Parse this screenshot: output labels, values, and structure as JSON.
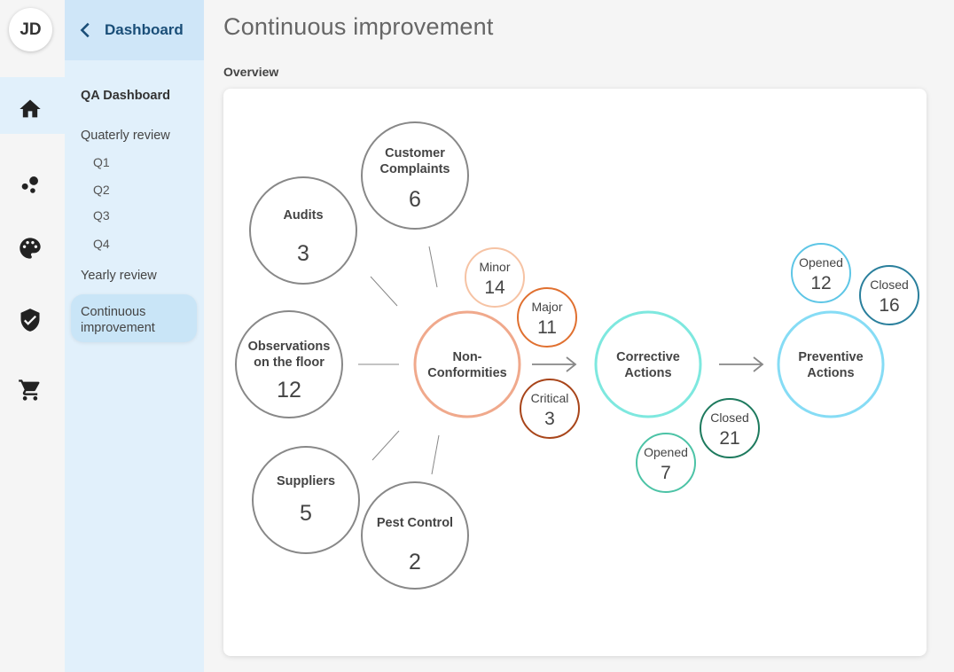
{
  "user": {
    "initials": "JD"
  },
  "rail": [
    {
      "icon": "home-icon"
    },
    {
      "icon": "bubbles-icon"
    },
    {
      "icon": "palette-icon"
    },
    {
      "icon": "shield-check-icon"
    },
    {
      "icon": "cart-icon"
    }
  ],
  "nav": {
    "back_label": "Dashboard",
    "section": "QA Dashboard",
    "quarterly": "Quaterly review",
    "quarters": [
      "Q1",
      "Q2",
      "Q3",
      "Q4"
    ],
    "yearly": "Yearly review",
    "continuous": "Continuous improvement"
  },
  "page": {
    "title": "Continuous improvement",
    "section": "Overview"
  },
  "diagram": {
    "sources": [
      {
        "label": [
          "Customer",
          "Complaints"
        ],
        "value": "6"
      },
      {
        "label": [
          "Audits"
        ],
        "value": "3"
      },
      {
        "label": [
          "Observations",
          "on the floor"
        ],
        "value": "12"
      },
      {
        "label": [
          "Suppliers"
        ],
        "value": "5"
      },
      {
        "label": [
          "Pest Control"
        ],
        "value": "2"
      }
    ],
    "nonconformities": {
      "label": [
        "Non-",
        "Conformities"
      ],
      "breakdown": [
        {
          "label": "Minor",
          "value": "14",
          "color": "#f6c3a4"
        },
        {
          "label": "Major",
          "value": "11",
          "color": "#e07030"
        },
        {
          "label": "Critical",
          "value": "3",
          "color": "#a8451a"
        }
      ],
      "color": "#f0a98c"
    },
    "corrective": {
      "label": [
        "Corrective",
        "Actions"
      ],
      "color": "#7ee8df",
      "breakdown": [
        {
          "label": "Opened",
          "value": "7",
          "color": "#4cc3a6"
        },
        {
          "label": "Closed",
          "value": "21",
          "color": "#1e7a5e"
        }
      ]
    },
    "preventive": {
      "label": [
        "Preventive",
        "Actions"
      ],
      "color": "#86dcf5",
      "breakdown": [
        {
          "label": "Opened",
          "value": "12",
          "color": "#5ec6e6"
        },
        {
          "label": "Closed",
          "value": "16",
          "color": "#2a7f9c"
        }
      ]
    }
  }
}
